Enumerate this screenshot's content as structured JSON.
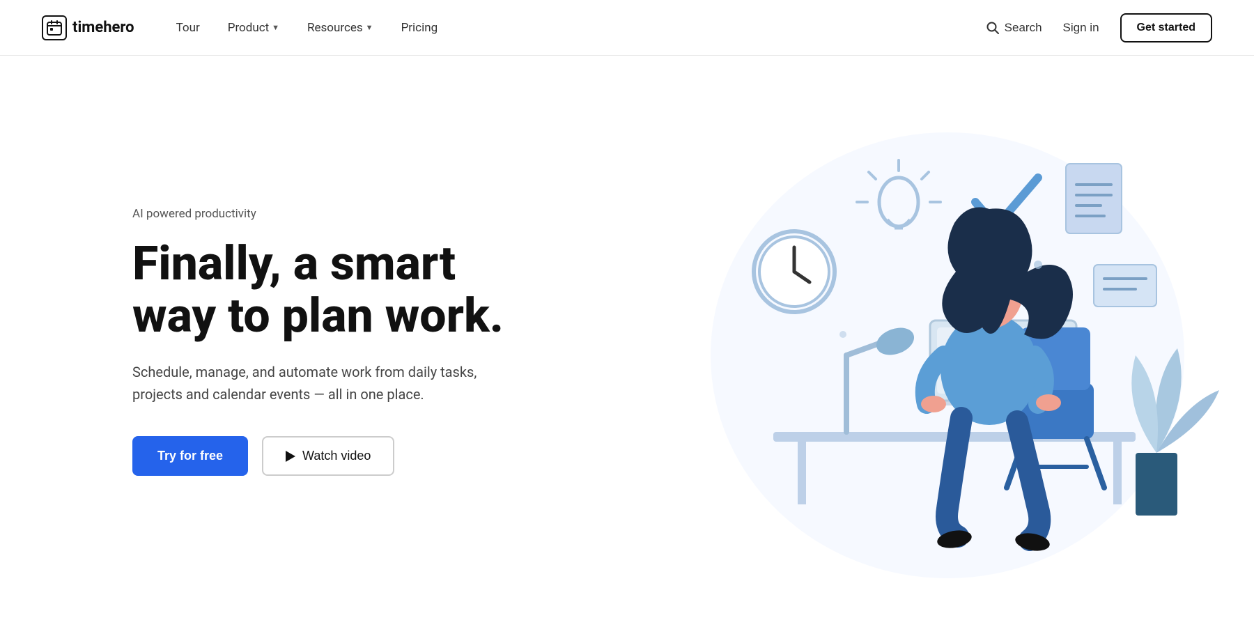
{
  "header": {
    "logo": {
      "icon": "📅",
      "text": "timehero"
    },
    "nav": {
      "items": [
        {
          "label": "Tour",
          "dropdown": false
        },
        {
          "label": "Product",
          "dropdown": true
        },
        {
          "label": "Resources",
          "dropdown": true
        },
        {
          "label": "Pricing",
          "dropdown": false
        }
      ]
    },
    "right": {
      "search_label": "Search",
      "sign_in_label": "Sign in",
      "get_started_label": "Get started"
    }
  },
  "hero": {
    "subtitle": "AI powered productivity",
    "title": "Finally, a smart\nway to plan work.",
    "description": "Schedule, manage, and automate work from daily tasks, projects and calendar events — all in one place.",
    "try_free_label": "Try for free",
    "watch_video_label": "Watch video"
  }
}
